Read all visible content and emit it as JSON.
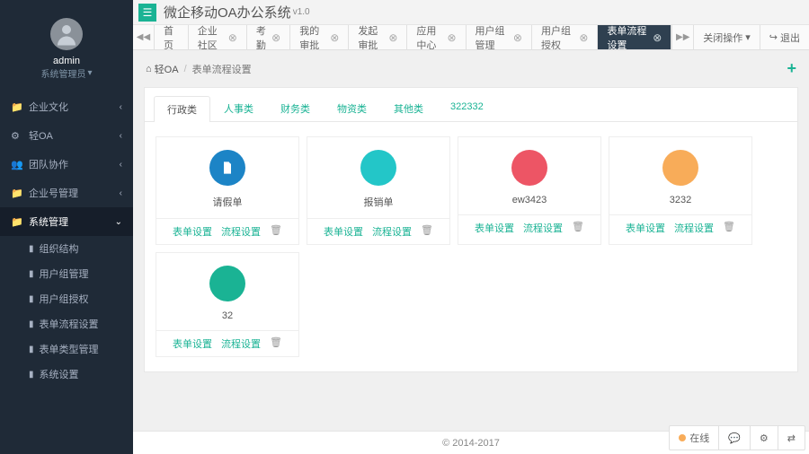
{
  "brand": {
    "title": "微企移动OA办公系统",
    "version": "v1.0"
  },
  "user": {
    "name": "admin",
    "role": "系统管理员",
    "role_caret": "▾"
  },
  "sidebar": {
    "items": [
      {
        "icon": "📁",
        "label": "企业文化"
      },
      {
        "icon": "⚙",
        "label": "轻OA"
      },
      {
        "icon": "👥",
        "label": "团队协作"
      },
      {
        "icon": "📁",
        "label": "企业号管理"
      },
      {
        "icon": "📁",
        "label": "系统管理",
        "active": true
      }
    ],
    "subs": [
      {
        "label": "组织结构"
      },
      {
        "label": "用户组管理"
      },
      {
        "label": "用户组授权"
      },
      {
        "label": "表单流程设置"
      },
      {
        "label": "表单类型管理"
      },
      {
        "label": "系统设置"
      }
    ]
  },
  "tabs": {
    "scroll_left": "◀◀",
    "scroll_right": "▶▶",
    "items": [
      {
        "label": "首页",
        "closable": false
      },
      {
        "label": "企业社区",
        "closable": true
      },
      {
        "label": "考勤",
        "closable": true
      },
      {
        "label": "我的审批",
        "closable": true
      },
      {
        "label": "发起审批",
        "closable": true
      },
      {
        "label": "应用中心",
        "closable": true
      },
      {
        "label": "用户组管理",
        "closable": true
      },
      {
        "label": "用户组授权",
        "closable": true
      },
      {
        "label": "表单流程设置",
        "closable": true,
        "active": true
      }
    ],
    "ops": "关闭操作",
    "ops_caret": "▾",
    "exit": "退出",
    "exit_icon": "↪"
  },
  "breadcrumb": {
    "home_icon": "⌂",
    "home": "轻OA",
    "current": "表单流程设置",
    "add": "+"
  },
  "subtabs": [
    {
      "label": "行政类",
      "active": true
    },
    {
      "label": "人事类"
    },
    {
      "label": "财务类"
    },
    {
      "label": "物资类"
    },
    {
      "label": "其他类"
    },
    {
      "label": "322332"
    }
  ],
  "cards": {
    "action_form": "表单设置",
    "action_flow": "流程设置",
    "action_del": "🗑",
    "items": [
      {
        "title": "请假单",
        "color": "#1c84c6",
        "icon": "file"
      },
      {
        "title": "报销单",
        "color": "#23c6c8",
        "icon": ""
      },
      {
        "title": "ew3423",
        "color": "#ed5565",
        "icon": ""
      },
      {
        "title": "3232",
        "color": "#f8ac59",
        "icon": ""
      },
      {
        "title": "32",
        "color": "#1ab394",
        "icon": ""
      }
    ]
  },
  "footer": {
    "copyright": "© 2014-2017"
  },
  "dock": {
    "online": "在线",
    "chat": "💬",
    "gear": "⚙",
    "swap": "⇄"
  }
}
